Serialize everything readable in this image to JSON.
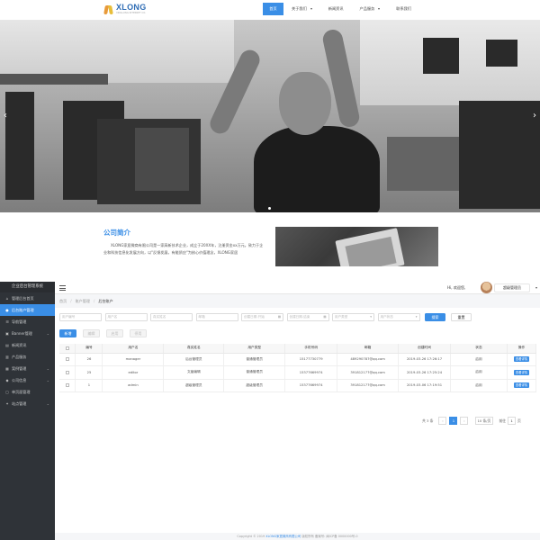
{
  "site": {
    "logo": {
      "name": "XLONG",
      "subtitle": "XINGLONG INTERNET CO."
    },
    "nav": [
      {
        "label": "首页",
        "active": true,
        "dropdown": false
      },
      {
        "label": "关于我们",
        "active": false,
        "dropdown": true
      },
      {
        "label": "新闻资讯",
        "active": false,
        "dropdown": false
      },
      {
        "label": "产品服务",
        "active": false,
        "dropdown": true
      },
      {
        "label": "联系我们",
        "active": false,
        "dropdown": false
      }
    ],
    "hero": {
      "prev_icon": "chevron-left-icon",
      "next_icon": "chevron-right-icon"
    },
    "intro": {
      "title": "公司简介",
      "text": "XLONG家居微商有限公司是一家高新技术企业，成立于20XX年，注册资金xx万元。致力于企业和科技信息化发展方向，以\"反馈发展，有能质应\"为核心价值理念，XLONG家居"
    }
  },
  "admin": {
    "sidebar": {
      "title": "企业后台管理系统",
      "items": [
        {
          "label": "管理后台首页",
          "icon": "home-icon",
          "active": false,
          "chevron": false
        },
        {
          "label": "后台账户管理",
          "icon": "user-icon",
          "active": true,
          "chevron": false
        },
        {
          "label": "导航管理",
          "icon": "nav-icon",
          "active": false,
          "chevron": false
        },
        {
          "label": "Banner管理",
          "icon": "image-icon",
          "active": false,
          "chevron": true
        },
        {
          "label": "新闻资讯",
          "icon": "news-icon",
          "active": false,
          "chevron": false
        },
        {
          "label": "产品服务",
          "icon": "product-icon",
          "active": false,
          "chevron": false
        },
        {
          "label": "案例管理",
          "icon": "case-icon",
          "active": false,
          "chevron": true
        },
        {
          "label": "公司信息",
          "icon": "company-icon",
          "active": false,
          "chevron": true
        },
        {
          "label": "单页面管理",
          "icon": "page-icon",
          "active": false,
          "chevron": false
        },
        {
          "label": "站点管理",
          "icon": "site-icon",
          "active": false,
          "chevron": true
        }
      ]
    },
    "topbar": {
      "greeting": "Hi, 欢迎您,",
      "user": "超级管理员"
    },
    "breadcrumb": [
      "首页",
      "账户管理",
      "后台账户"
    ],
    "filters": {
      "placeholders": [
        "用户编号",
        "用户名",
        "真实姓名",
        "邮箱",
        "创建日期-开始",
        "创建日期-结束",
        "用户类型",
        "用户状态"
      ],
      "search": "搜索",
      "reset": "重置"
    },
    "actions": [
      "新增",
      "编辑",
      "启用",
      "停用"
    ],
    "table": {
      "headers": [
        "",
        "编号",
        "用户名",
        "真实姓名",
        "用户类型",
        "手机号码",
        "邮箱",
        "创建时间",
        "状态",
        "操作"
      ],
      "rows": [
        {
          "id": "26",
          "username": "manager",
          "real_name": "后台管理员",
          "type": "普通管理员",
          "phone": "15177730779",
          "email": "489290787@qq.com",
          "created": "2019-03-26 17:26:17",
          "status": "启用",
          "op": "查看详情"
        },
        {
          "id": "25",
          "username": "editor",
          "real_name": "文章编辑",
          "type": "普通管理员",
          "phone": "15377669974",
          "email": "391812177@qq.com",
          "created": "2019-03-26 17:25:24",
          "status": "启用",
          "op": "查看详情"
        },
        {
          "id": "1",
          "username": "admin",
          "real_name": "超级管理员",
          "type": "超级管理员",
          "phone": "15377669974",
          "email": "391812177@qq.com",
          "created": "2019-03-06 17:19:51",
          "status": "启用",
          "op": "查看详情"
        }
      ]
    },
    "pager": {
      "total": "共 3 条",
      "prev": "‹",
      "page": "1",
      "next": "›",
      "size": "10 条/页",
      "goto": "前往",
      "goto_value": "1",
      "page_unit": "页"
    },
    "footer": {
      "prefix": "Copyright © 2019",
      "brand": "XLONG家居微商有限公司",
      "suffix": "版权所有 备案号: 闽ICP备 0000000号-0"
    }
  }
}
